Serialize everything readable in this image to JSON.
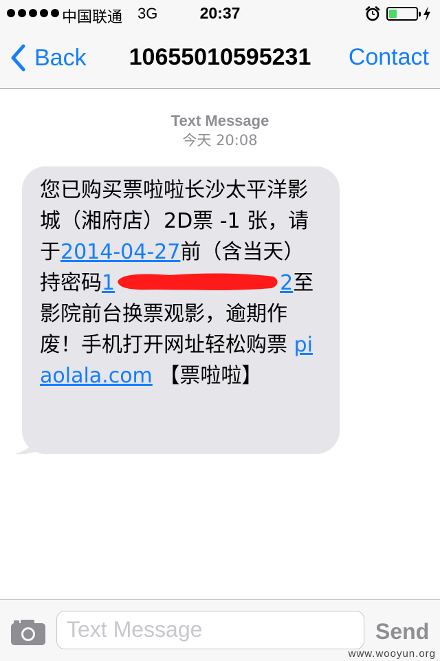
{
  "status_bar": {
    "carrier": "中国联通",
    "network": "3G",
    "time": "20:37",
    "battery_level": 0.3,
    "icons": [
      "signal-dots-icon",
      "alarm-clock-icon",
      "battery-icon",
      "charging-bolt-icon"
    ]
  },
  "nav": {
    "back_label": "Back",
    "title": "10655010595231",
    "contact_label": "Contact"
  },
  "thread": {
    "kind": "Text Message",
    "timestamp": "今天 20:08"
  },
  "message": {
    "text_1": "您已购买票啦啦长沙太平洋影城（湘府店）2D票 -1 张，请于",
    "date_link": "2014-04-27",
    "text_2": "前（含当天）持密码",
    "code_start": "1",
    "code_end": "2",
    "text_3": "至影院前台换票观影，逾期作废！手机打开网址轻松购票 ",
    "url_link": "piaolala.com",
    "text_4": " 【票啦啦】"
  },
  "input_bar": {
    "placeholder": "Text Message",
    "send_label": "Send"
  },
  "watermark": "www.wooyun.org",
  "colors": {
    "accent": "#157efb",
    "bubble": "#e5e5ea",
    "bar": "#f7f7f8",
    "redaction": "#ff1a1a",
    "battery": "#4cd964"
  }
}
